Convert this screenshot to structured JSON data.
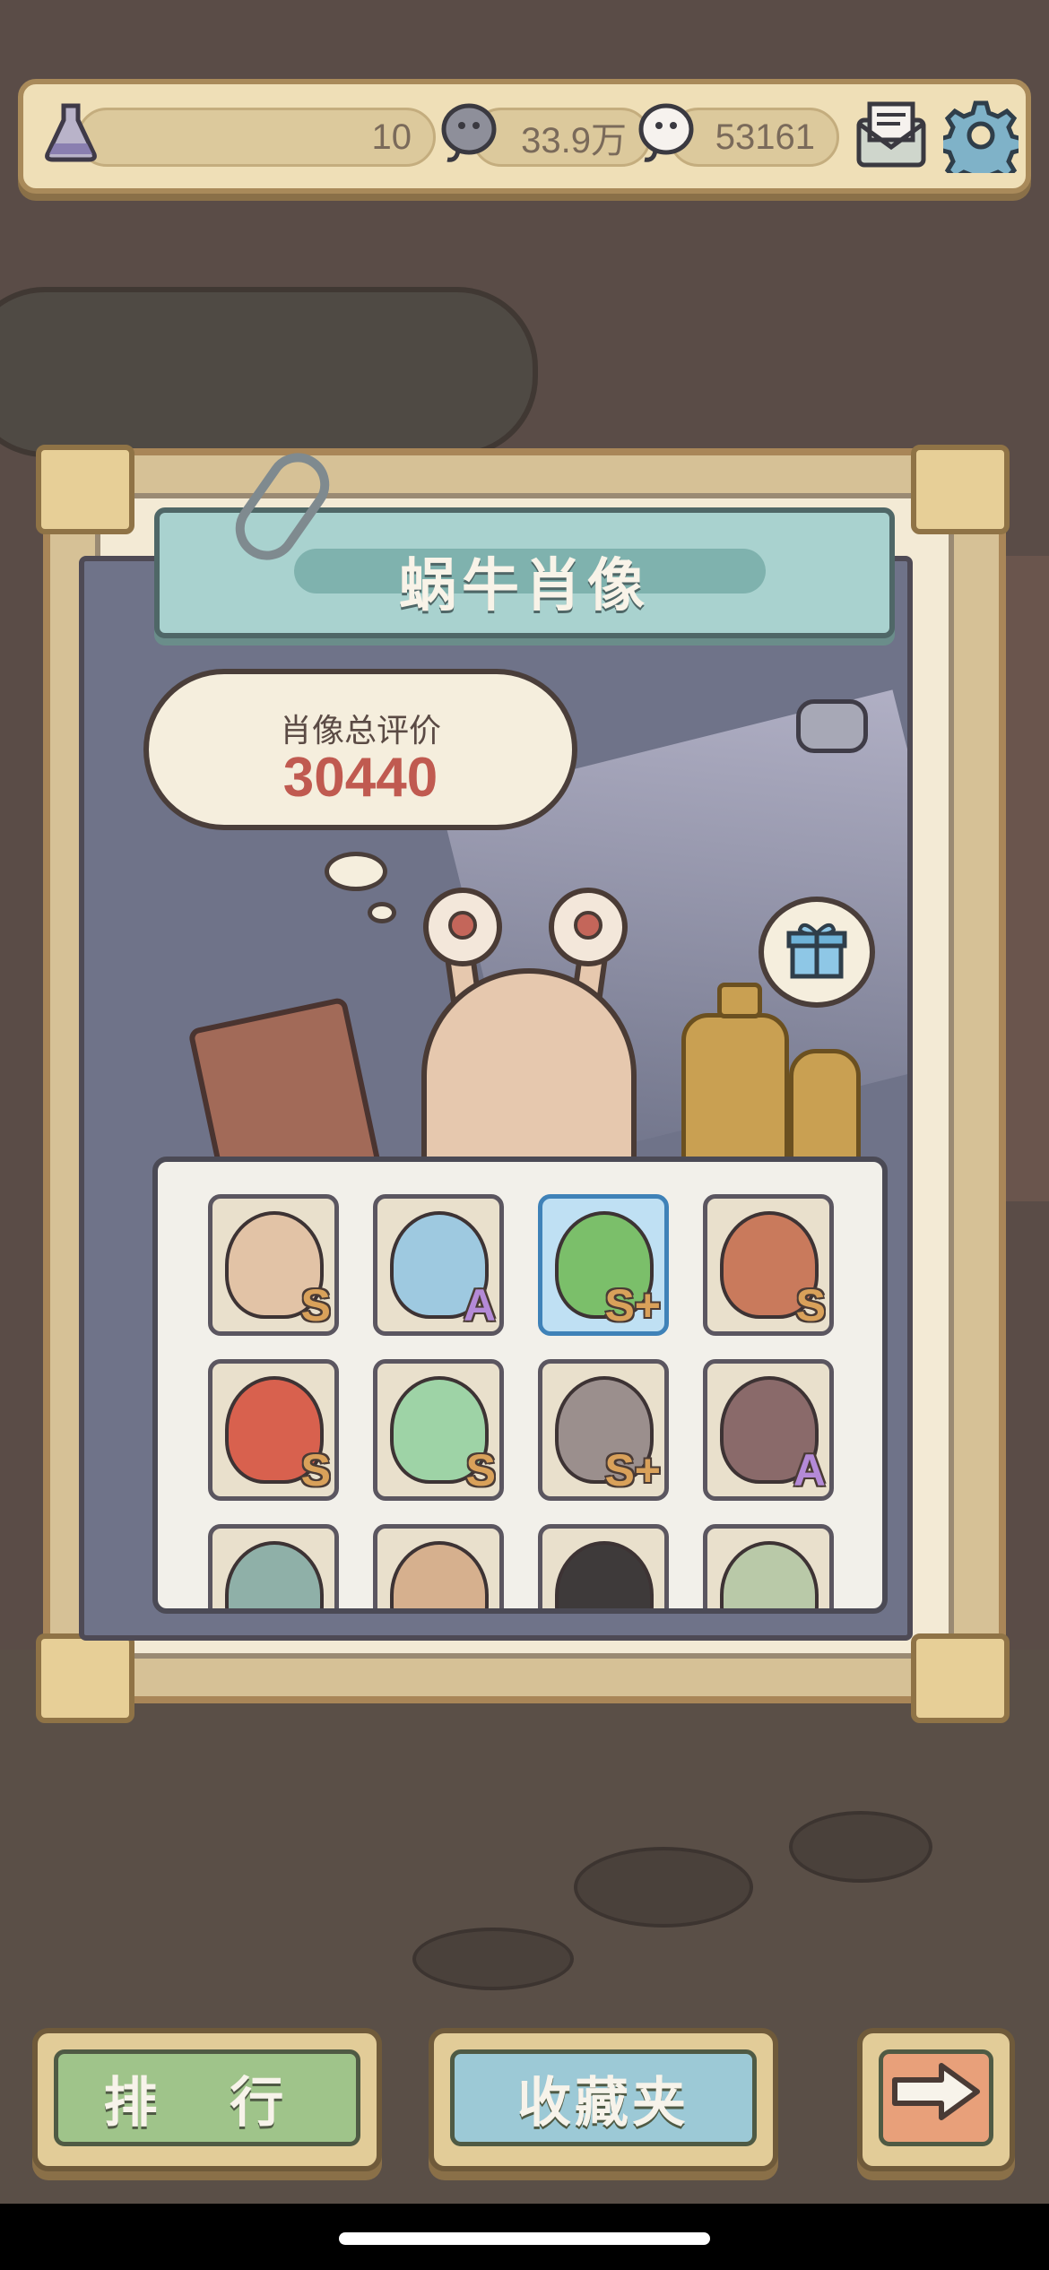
{
  "resources": {
    "potion": {
      "value": "10",
      "icon": "potion-flask-icon"
    },
    "dark_tadpole": {
      "value": "33.9万",
      "icon": "dark-tadpole-icon"
    },
    "white_tadpole": {
      "value": "53161",
      "icon": "white-tadpole-icon"
    }
  },
  "top_buttons": {
    "mail_icon": "mail-icon",
    "settings_icon": "gear-icon"
  },
  "portrait": {
    "title": "蜗牛肖像",
    "score_label": "肖像总评价",
    "score_value": "30440",
    "gift_icon": "gift-icon"
  },
  "cards": [
    {
      "grade": "S",
      "color": "#e2c3a6"
    },
    {
      "grade": "A",
      "color": "#9ec9e0"
    },
    {
      "grade": "S+",
      "color": "#7bbf6a"
    },
    {
      "grade": "S",
      "color": "#c97a5c"
    },
    {
      "grade": "S",
      "color": "#d8614e"
    },
    {
      "grade": "S",
      "color": "#9ed3a6"
    },
    {
      "grade": "S+",
      "color": "#9b8f8d"
    },
    {
      "grade": "A",
      "color": "#8a6a6a"
    },
    {
      "grade": "",
      "color": "#8fb0a8"
    },
    {
      "grade": "",
      "color": "#d6b08e"
    },
    {
      "grade": "",
      "color": "#3e3a3a"
    },
    {
      "grade": "",
      "color": "#b9c9a8"
    }
  ],
  "bottom_buttons": {
    "rank": {
      "label": "排 行",
      "color": "#9fc48a"
    },
    "collection": {
      "label": "收藏夹",
      "color": "#9cc9d6"
    },
    "next": {
      "icon": "arrow-right-icon",
      "color": "#e8a07a"
    }
  }
}
